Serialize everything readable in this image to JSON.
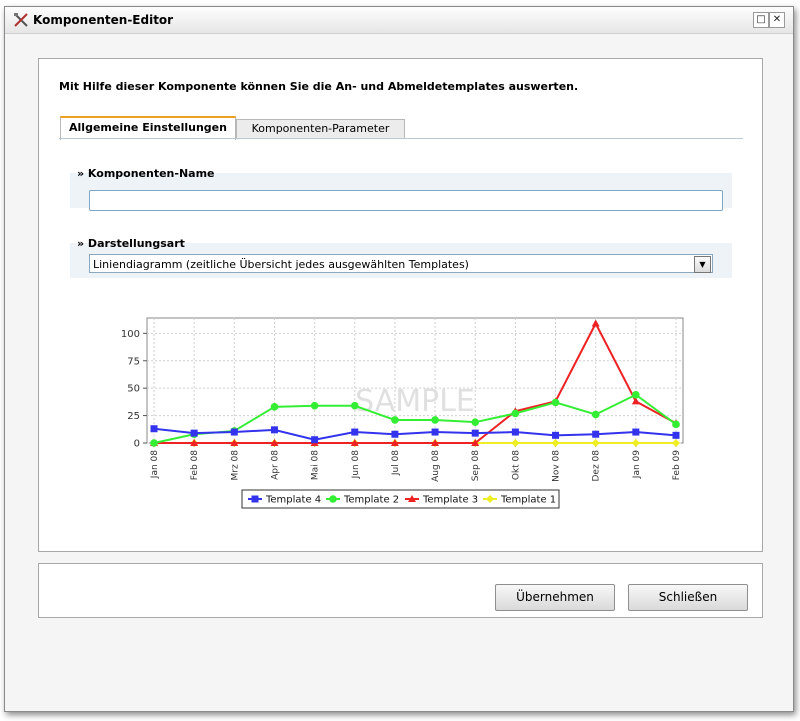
{
  "window": {
    "title": "Komponenten-Editor",
    "icon": "tools-icon",
    "maximize_glyph": "□",
    "close_glyph": "✕"
  },
  "intro_text": "Mit Hilfe dieser Komponente können Sie die An- und Abmeldetemplates auswerten.",
  "tabs": [
    {
      "label": "Allgemeine Einstellungen",
      "active": true
    },
    {
      "label": "Komponenten-Parameter",
      "active": false
    }
  ],
  "fields": {
    "name": {
      "label": "» Komponenten-Name",
      "value": ""
    },
    "display_type": {
      "label": "» Darstellungsart",
      "value": "Liniendiagramm (zeitliche Übersicht jedes ausgewählten Templates)",
      "arrow": "▼"
    }
  },
  "chart_data": {
    "type": "line",
    "watermark": "SAMPLE",
    "x": [
      "Jan 08",
      "Feb 08",
      "Mrz 08",
      "Apr 08",
      "Mai 08",
      "Jun 08",
      "Jul 08",
      "Aug 08",
      "Sep 08",
      "Okt 08",
      "Nov 08",
      "Dez 08",
      "Jan 09",
      "Feb 09"
    ],
    "yticks": [
      "0",
      "25",
      "50",
      "75",
      "100"
    ],
    "ylim": [
      0,
      114
    ],
    "grid": true,
    "legend_position": "bottom",
    "series": [
      {
        "name": "Template 4",
        "color": "#3333ee",
        "marker": "square",
        "values": [
          13,
          9,
          10,
          12,
          3,
          10,
          8,
          10,
          9,
          10,
          7,
          8,
          10,
          7
        ]
      },
      {
        "name": "Template 2",
        "color": "#33ee33",
        "marker": "circle",
        "values": [
          0,
          8,
          11,
          33,
          34,
          34,
          21,
          21,
          19,
          27,
          37,
          26,
          44,
          17
        ]
      },
      {
        "name": "Template 3",
        "color": "#ee2222",
        "marker": "triangle",
        "values": [
          0,
          0,
          0,
          0,
          0,
          0,
          0,
          0,
          0,
          29,
          38,
          109,
          38,
          18
        ]
      },
      {
        "name": "Template 1",
        "color": "#eeee22",
        "marker": "diamond",
        "values": [
          0,
          0,
          0,
          0,
          0,
          0,
          0,
          0,
          0,
          0,
          0,
          0,
          0,
          0
        ]
      }
    ]
  },
  "buttons": {
    "apply": "Übernehmen",
    "close": "Schließen"
  }
}
